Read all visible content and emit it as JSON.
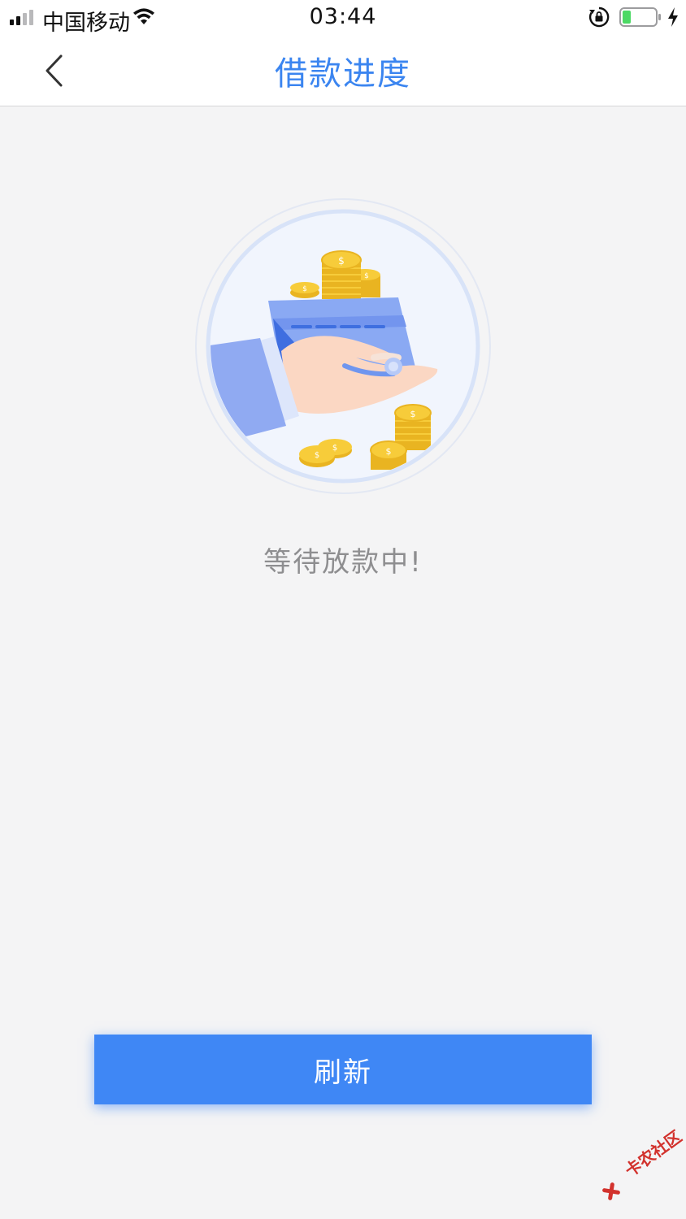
{
  "status_bar": {
    "carrier": "中国移动",
    "time": "03:44"
  },
  "nav": {
    "title": "借款进度",
    "back_icon": "chevron-left-icon"
  },
  "main": {
    "illustration": "hand-card-coins-illustration",
    "status_text": "等待放款中!"
  },
  "actions": {
    "refresh_label": "刷新"
  },
  "watermark": {
    "text": "卡农社区"
  },
  "colors": {
    "accent": "#3f87f5",
    "title": "#3b85f0",
    "background": "#f4f4f5",
    "status_text": "#8e8e90"
  }
}
